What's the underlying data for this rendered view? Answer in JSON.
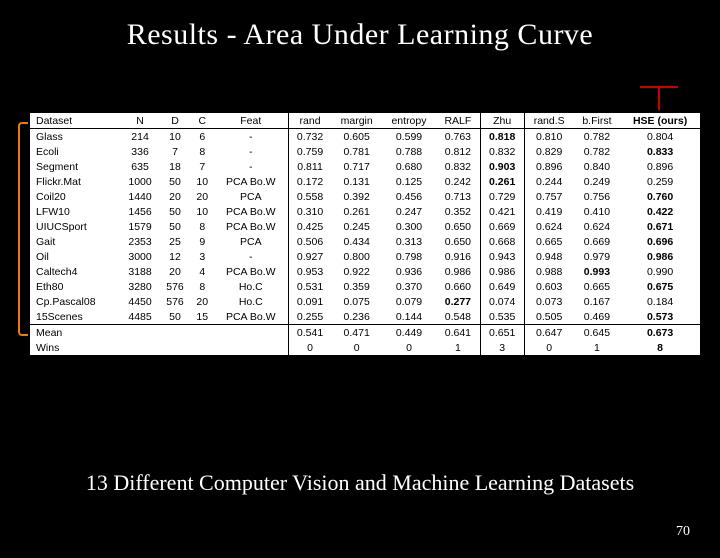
{
  "title": "Results - Area Under Learning Curve",
  "subtitle": "13 Different Computer Vision and Machine Learning Datasets",
  "slide_number": "70",
  "chart_data": {
    "type": "table",
    "columns": [
      "Dataset",
      "N",
      "D",
      "C",
      "Feat",
      "rand",
      "margin",
      "entropy",
      "RALF",
      "Zhu",
      "rand.S",
      "b.First",
      "HSE (ours)"
    ],
    "rows": [
      {
        "dataset": "Glass",
        "N": "214",
        "D": "10",
        "C": "6",
        "Feat": "-",
        "rand": "0.732",
        "margin": "0.605",
        "entropy": "0.599",
        "RALF": "0.763",
        "Zhu": "0.818",
        "randS": "0.810",
        "bFirst": "0.782",
        "HSE": "0.804"
      },
      {
        "dataset": "Ecoli",
        "N": "336",
        "D": "7",
        "C": "8",
        "Feat": "-",
        "rand": "0.759",
        "margin": "0.781",
        "entropy": "0.788",
        "RALF": "0.812",
        "Zhu": "0.832",
        "randS": "0.829",
        "bFirst": "0.782",
        "HSE": "0.833"
      },
      {
        "dataset": "Segment",
        "N": "635",
        "D": "18",
        "C": "7",
        "Feat": "-",
        "rand": "0.811",
        "margin": "0.717",
        "entropy": "0.680",
        "RALF": "0.832",
        "Zhu": "0.903",
        "randS": "0.896",
        "bFirst": "0.840",
        "HSE": "0.896"
      },
      {
        "dataset": "Flickr.Mat",
        "N": "1000",
        "D": "50",
        "C": "10",
        "Feat": "PCA Bo.W",
        "rand": "0.172",
        "margin": "0.131",
        "entropy": "0.125",
        "RALF": "0.242",
        "Zhu": "0.261",
        "randS": "0.244",
        "bFirst": "0.249",
        "HSE": "0.259"
      },
      {
        "dataset": "Coil20",
        "N": "1440",
        "D": "20",
        "C": "20",
        "Feat": "PCA",
        "rand": "0.558",
        "margin": "0.392",
        "entropy": "0.456",
        "RALF": "0.713",
        "Zhu": "0.729",
        "randS": "0.757",
        "bFirst": "0.756",
        "HSE": "0.760"
      },
      {
        "dataset": "LFW10",
        "N": "1456",
        "D": "50",
        "C": "10",
        "Feat": "PCA Bo.W",
        "rand": "0.310",
        "margin": "0.261",
        "entropy": "0.247",
        "RALF": "0.352",
        "Zhu": "0.421",
        "randS": "0.419",
        "bFirst": "0.410",
        "HSE": "0.422"
      },
      {
        "dataset": "UIUCSport",
        "N": "1579",
        "D": "50",
        "C": "8",
        "Feat": "PCA Bo.W",
        "rand": "0.425",
        "margin": "0.245",
        "entropy": "0.300",
        "RALF": "0.650",
        "Zhu": "0.669",
        "randS": "0.624",
        "bFirst": "0.624",
        "HSE": "0.671"
      },
      {
        "dataset": "Gait",
        "N": "2353",
        "D": "25",
        "C": "9",
        "Feat": "PCA",
        "rand": "0.506",
        "margin": "0.434",
        "entropy": "0.313",
        "RALF": "0.650",
        "Zhu": "0.668",
        "randS": "0.665",
        "bFirst": "0.669",
        "HSE": "0.696"
      },
      {
        "dataset": "Oil",
        "N": "3000",
        "D": "12",
        "C": "3",
        "Feat": "-",
        "rand": "0.927",
        "margin": "0.800",
        "entropy": "0.798",
        "RALF": "0.916",
        "Zhu": "0.943",
        "randS": "0.948",
        "bFirst": "0.979",
        "HSE": "0.986"
      },
      {
        "dataset": "Caltech4",
        "N": "3188",
        "D": "20",
        "C": "4",
        "Feat": "PCA Bo.W",
        "rand": "0.953",
        "margin": "0.922",
        "entropy": "0.936",
        "RALF": "0.986",
        "Zhu": "0.986",
        "randS": "0.988",
        "bFirst": "0.993",
        "HSE": "0.990"
      },
      {
        "dataset": "Eth80",
        "N": "3280",
        "D": "576",
        "C": "8",
        "Feat": "Ho.C",
        "rand": "0.531",
        "margin": "0.359",
        "entropy": "0.370",
        "RALF": "0.660",
        "Zhu": "0.649",
        "randS": "0.603",
        "bFirst": "0.665",
        "HSE": "0.675"
      },
      {
        "dataset": "Cp.Pascal08",
        "N": "4450",
        "D": "576",
        "C": "20",
        "Feat": "Ho.C",
        "rand": "0.091",
        "margin": "0.075",
        "entropy": "0.079",
        "RALF": "0.277",
        "Zhu": "0.074",
        "randS": "0.073",
        "bFirst": "0.167",
        "HSE": "0.184"
      },
      {
        "dataset": "15Scenes",
        "N": "4485",
        "D": "50",
        "C": "15",
        "Feat": "PCA Bo.W",
        "rand": "0.255",
        "margin": "0.236",
        "entropy": "0.144",
        "RALF": "0.548",
        "Zhu": "0.535",
        "randS": "0.505",
        "bFirst": "0.469",
        "HSE": "0.573"
      }
    ],
    "mean": {
      "rand": "0.541",
      "margin": "0.471",
      "entropy": "0.449",
      "RALF": "0.641",
      "Zhu": "0.651",
      "randS": "0.647",
      "bFirst": "0.645",
      "HSE": "0.673"
    },
    "wins": {
      "rand": "0",
      "margin": "0",
      "entropy": "0",
      "RALF": "1",
      "Zhu": "3",
      "randS": "0",
      "bFirst": "1",
      "HSE": "8"
    },
    "bold_cells": {
      "Glass": "Zhu",
      "Ecoli": "HSE",
      "Segment": "Zhu",
      "Flickr.Mat": "Zhu",
      "Coil20": "HSE",
      "LFW10": "HSE",
      "UIUCSport": "HSE",
      "Gait": "HSE",
      "Oil": "HSE",
      "Caltech4": "bFirst",
      "Eth80": "HSE",
      "Cp.Pascal08": "RALF",
      "15Scenes": "HSE",
      "Mean": "HSE",
      "Wins": "HSE"
    }
  }
}
